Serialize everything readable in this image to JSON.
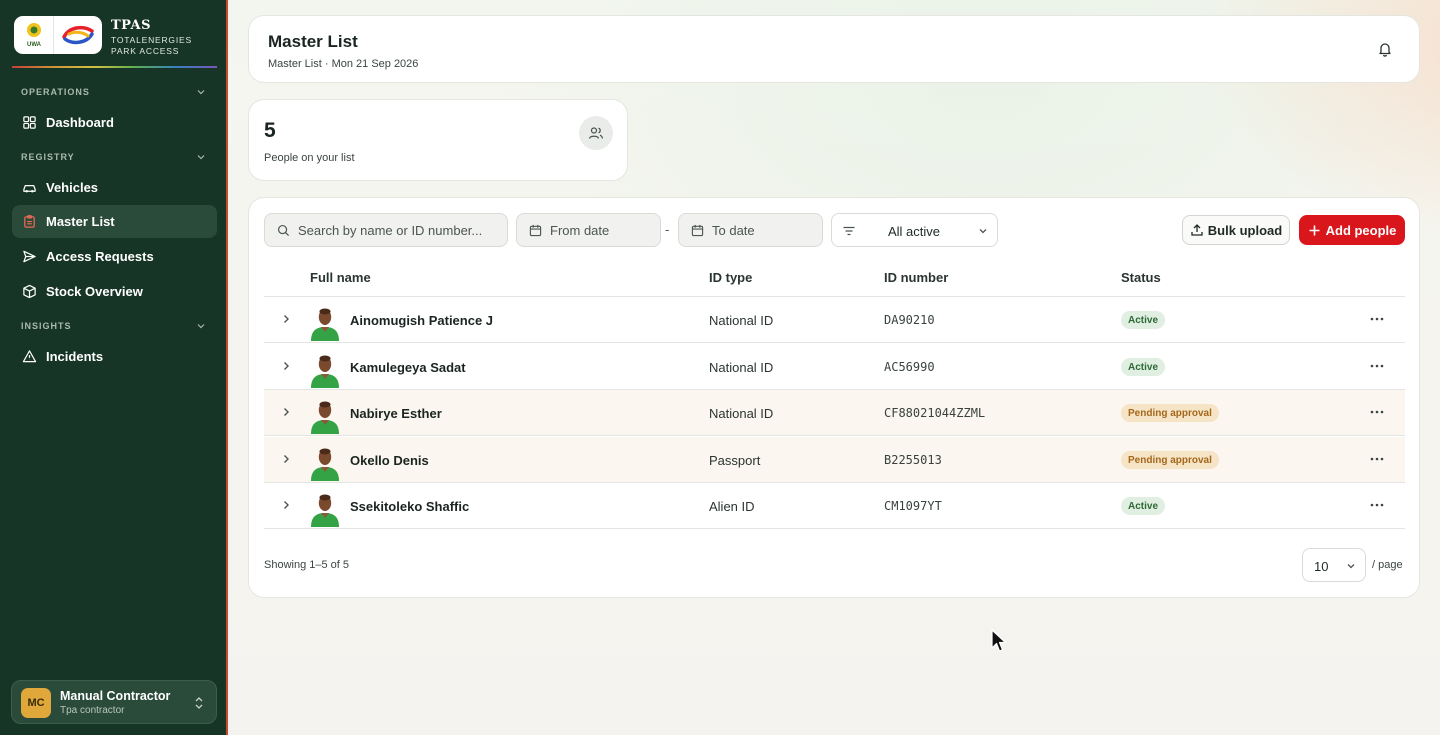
{
  "brand": {
    "uwa_logo_text": "UWA",
    "title": "TPAS",
    "subtitle_line1": "TOTALENERGIES",
    "subtitle_line2": "PARK ACCESS"
  },
  "sidebar": {
    "sections": [
      {
        "label": "OPERATIONS"
      },
      {
        "label": "REGISTRY"
      },
      {
        "label": "INSIGHTS"
      }
    ],
    "items": [
      {
        "label": "Dashboard",
        "icon": "grid-icon"
      },
      {
        "label": "Vehicles",
        "icon": "car-icon"
      },
      {
        "label": "Master List",
        "icon": "clipboard-icon",
        "active": true
      },
      {
        "label": "Access Requests",
        "icon": "send-icon"
      },
      {
        "label": "Stock Overview",
        "icon": "box-icon"
      },
      {
        "label": "Incidents",
        "icon": "warning-icon"
      }
    ],
    "user": {
      "initials": "MC",
      "name": "Manual Contractor",
      "role": "Tpa contractor"
    }
  },
  "header": {
    "title": "Master List",
    "subtitle": "Master List · Mon 21 Sep 2026"
  },
  "stat": {
    "value": "5",
    "label": "People on your list"
  },
  "toolbar": {
    "search_placeholder": "Search by name or ID number...",
    "from_placeholder": "From date",
    "separator": "-",
    "to_placeholder": "To date",
    "filter_value": "All active",
    "bulk_label": "Bulk upload",
    "add_label": "Add people"
  },
  "table": {
    "headers": [
      "Full name",
      "ID type",
      "ID number",
      "Status"
    ],
    "rows": [
      {
        "name": "Ainomugish Patience J",
        "id_type": "National ID",
        "id_number": "DA90210",
        "status": "Active"
      },
      {
        "name": "Kamulegeya Sadat",
        "id_type": "National ID",
        "id_number": "AC56990",
        "status": "Active"
      },
      {
        "name": "Nabirye Esther",
        "id_type": "National ID",
        "id_number": "CF88021044ZZML",
        "status": "Pending approval"
      },
      {
        "name": "Okello Denis",
        "id_type": "Passport",
        "id_number": "B2255013",
        "status": "Pending approval"
      },
      {
        "name": "Ssekitoleko Shaffic",
        "id_type": "Alien ID",
        "id_number": "CM1097YT",
        "status": "Active"
      }
    ]
  },
  "pagination": {
    "showing": "Showing 1–5 of 5",
    "page_size": "10",
    "per_page_label": "/ page"
  },
  "colors": {
    "sidebar": "#173527",
    "accent": "#d9161c",
    "active_badge": "#2d6a36",
    "pending_badge": "#a5671a"
  }
}
